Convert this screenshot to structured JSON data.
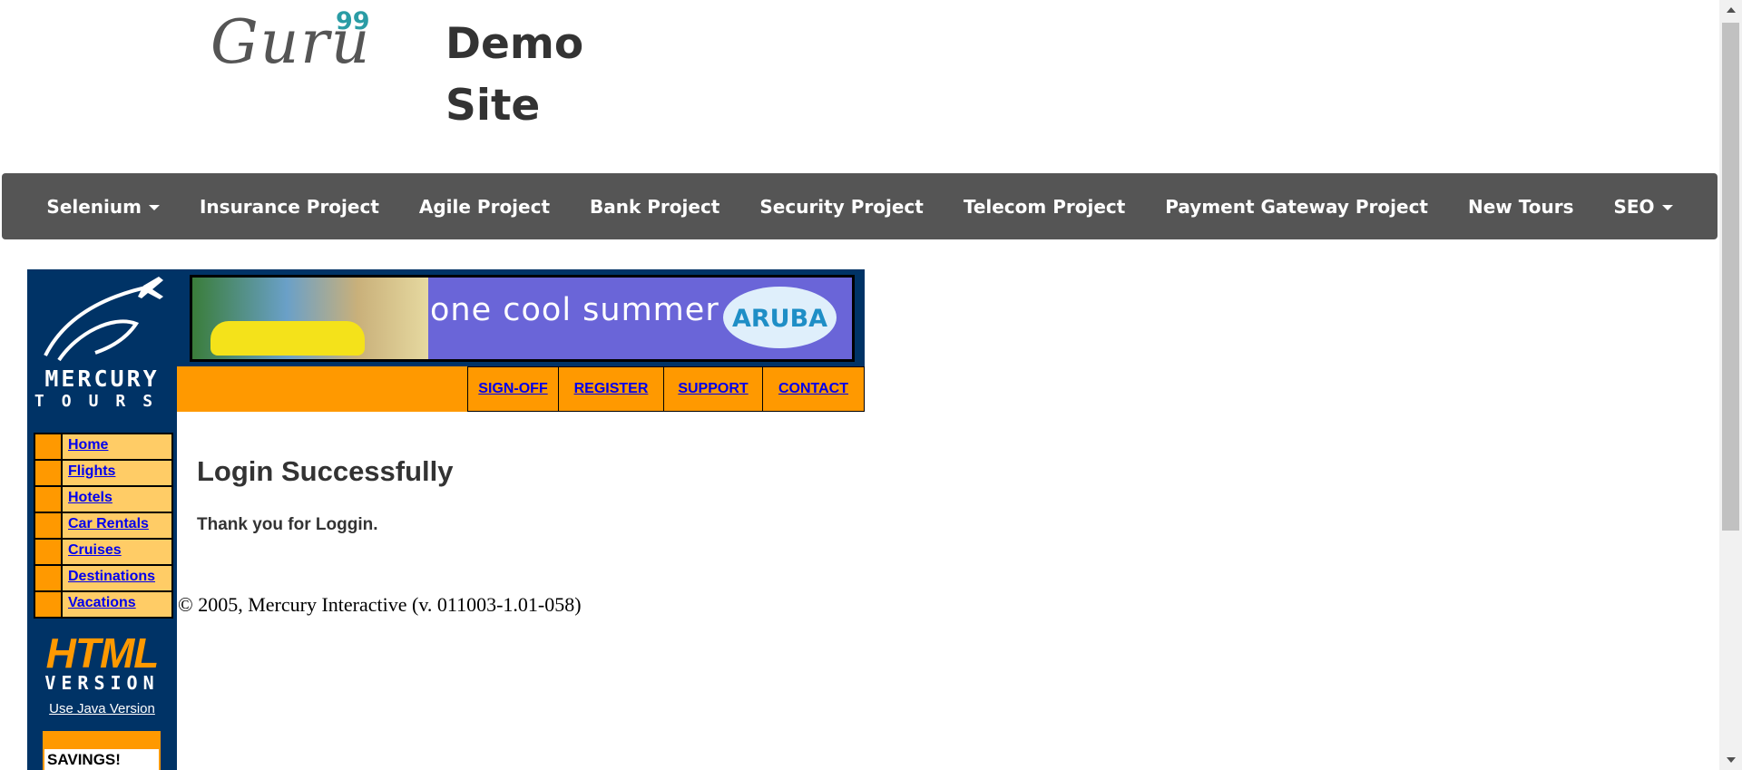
{
  "header": {
    "logo_text": "Guru",
    "logo_sup": "99",
    "site_title": "Demo Site"
  },
  "navbar": {
    "items": [
      {
        "label": "Selenium",
        "dropdown": true
      },
      {
        "label": "Insurance Project",
        "dropdown": false
      },
      {
        "label": "Agile Project",
        "dropdown": false
      },
      {
        "label": "Bank Project",
        "dropdown": false
      },
      {
        "label": "Security Project",
        "dropdown": false
      },
      {
        "label": "Telecom Project",
        "dropdown": false
      },
      {
        "label": "Payment Gateway Project",
        "dropdown": false
      },
      {
        "label": "New Tours",
        "dropdown": false
      },
      {
        "label": "SEO",
        "dropdown": true
      }
    ],
    "bg_color": "#555555"
  },
  "sidebar": {
    "logo_word": "MERCURY",
    "logo_sub": "TOURS",
    "menu": [
      "Home",
      "Flights",
      "Hotels",
      "Car Rentals",
      "Cruises",
      "Destinations",
      "Vacations"
    ],
    "html_version_big": "HTML",
    "html_version_small": "VERSION",
    "java_link": "Use Java Version",
    "savings": "SAVINGS!"
  },
  "banner": {
    "text": "one cool summer",
    "brand": "ARUBA"
  },
  "top_links": [
    "SIGN-OFF",
    "REGISTER",
    "SUPPORT",
    "CONTACT"
  ],
  "main": {
    "title": "Login Successfully",
    "message": "Thank you for Loggin.",
    "copyright": "© 2005, Mercury Interactive (v. 011003-1.01-058)"
  },
  "colors": {
    "mercury_blue": "#003366",
    "orange": "#ff9900",
    "menu_bg": "#ffcc66",
    "link": "#0000ee"
  }
}
